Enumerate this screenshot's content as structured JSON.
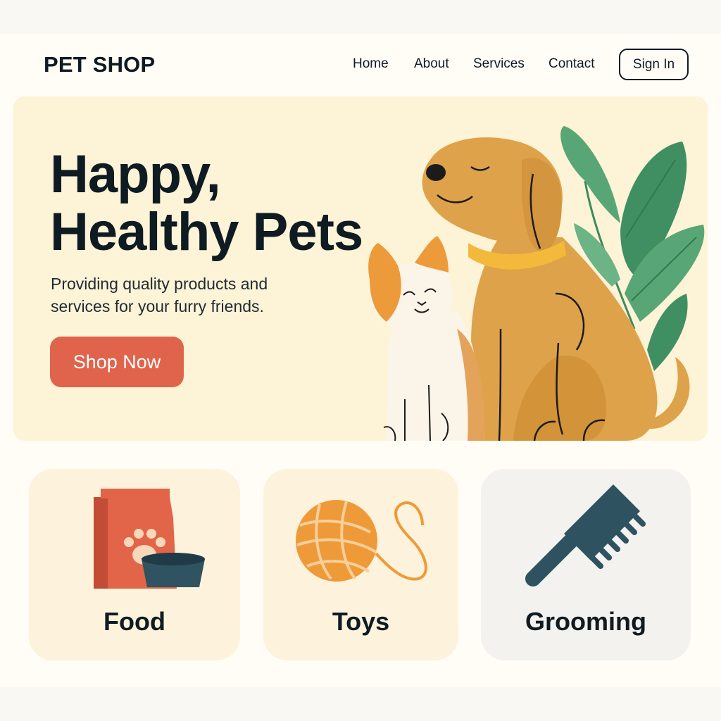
{
  "header": {
    "brand": "PET SHOP",
    "nav": [
      "Home",
      "About",
      "Services",
      "Contact"
    ],
    "sign_in_label": "Sign In"
  },
  "hero": {
    "title_lines": [
      "Happy,",
      "Healthy Pets"
    ],
    "subtitle_lines": [
      "Providing quality products and",
      "services for your furry friends."
    ],
    "cta_label": "Shop Now",
    "illustration": [
      "dog-illustration",
      "cat-illustration",
      "plant-illustration"
    ]
  },
  "categories": [
    {
      "label": "Food",
      "icon": "food-bag-icon"
    },
    {
      "label": "Toys",
      "icon": "yarn-ball-icon"
    },
    {
      "label": "Grooming",
      "icon": "comb-icon"
    }
  ],
  "colors": {
    "hero_background": "#fdf3d6",
    "accent": "#e0644b",
    "text": "#0f1b22",
    "card_warm": "#fdf2db",
    "card_neutral": "#f4f2ee",
    "dog": "#dea24a",
    "collar": "#f3b93b",
    "leaf": "#4f9e6e"
  }
}
